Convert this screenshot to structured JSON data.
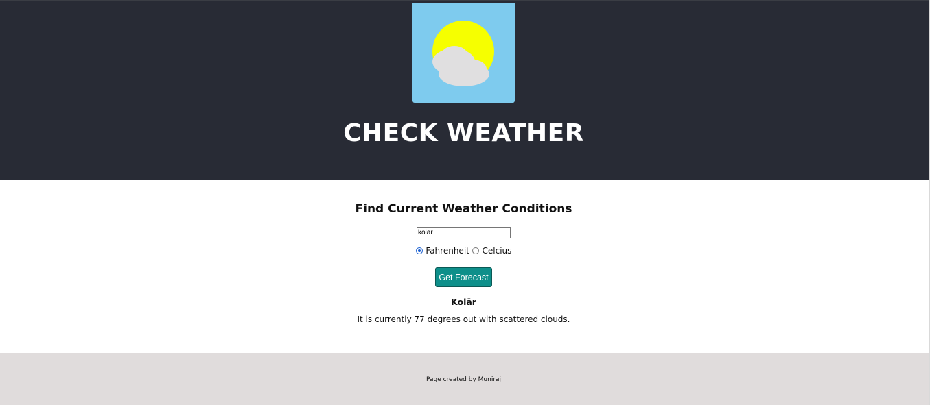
{
  "header": {
    "title": "CHECK WEATHER",
    "logo_icon": "sun-behind-cloud-icon",
    "colors": {
      "background": "#282b35",
      "logo_sky": "#7ecbee",
      "sun": "#f6ff00",
      "cloud": "#e0dfe0"
    }
  },
  "search": {
    "heading": "Find Current Weather Conditions",
    "city_value": "kolar",
    "units": {
      "fahrenheit_label": "Fahrenheit",
      "celcius_label": "Celcius",
      "selected": "Fahrenheit"
    },
    "button_label": "Get Forecast",
    "button_color": "#0e8f8a"
  },
  "result": {
    "city": "Kolār",
    "conditions": "It is currently 77 degrees out with scattered clouds."
  },
  "footer": {
    "text": "Page created by Muniraj",
    "background": "#e0dcdc"
  }
}
